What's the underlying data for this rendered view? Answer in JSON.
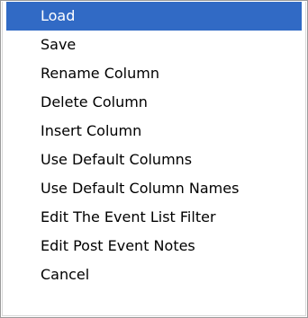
{
  "menu": {
    "highlight_color": "#316ac5",
    "items": [
      {
        "label": "Load",
        "highlighted": true
      },
      {
        "label": "Save",
        "highlighted": false
      },
      {
        "label": "Rename Column",
        "highlighted": false
      },
      {
        "label": "Delete Column",
        "highlighted": false
      },
      {
        "label": "Insert Column",
        "highlighted": false
      },
      {
        "label": "Use Default Columns",
        "highlighted": false
      },
      {
        "label": "Use Default Column Names",
        "highlighted": false
      },
      {
        "label": "Edit The Event List Filter",
        "highlighted": false
      },
      {
        "label": "Edit Post Event Notes",
        "highlighted": false
      },
      {
        "label": "Cancel",
        "highlighted": false
      }
    ]
  }
}
